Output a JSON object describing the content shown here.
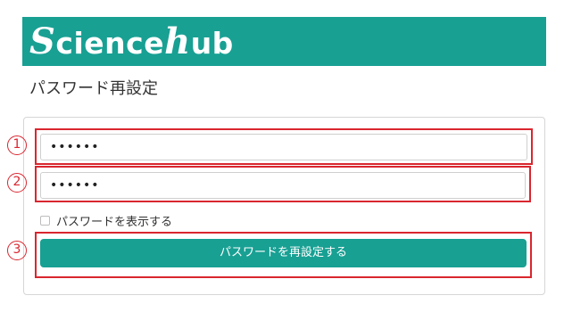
{
  "brand": {
    "logo_s": "S",
    "logo_mid": "cience",
    "logo_h": "h",
    "logo_end": "ub",
    "header_color": "#18a093"
  },
  "page": {
    "title": "パスワード再設定"
  },
  "form": {
    "new_password_value": "••••••",
    "confirm_password_value": "••••••",
    "show_password_label": "パスワードを表示する",
    "show_password_checked": false,
    "submit_label": "パスワードを再設定する"
  },
  "annotations": {
    "marker_1": "1",
    "marker_2": "2",
    "marker_3": "3",
    "outline_color": "#d9262f"
  }
}
